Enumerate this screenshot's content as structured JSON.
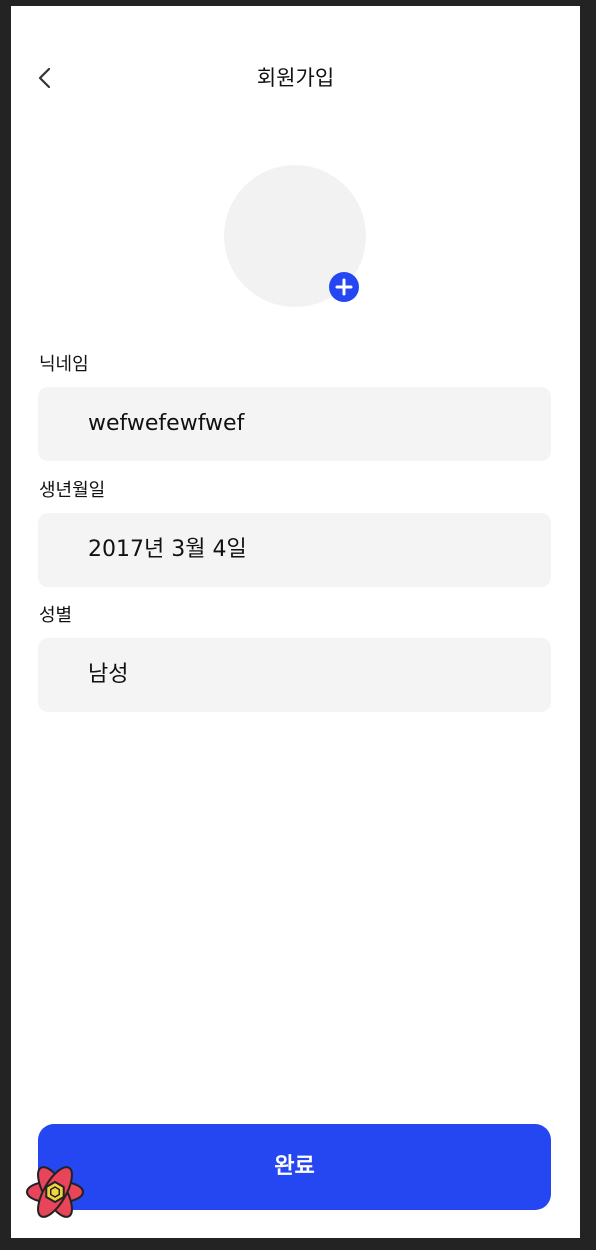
{
  "header": {
    "title": "회원가입",
    "back_icon": "chevron-left-icon"
  },
  "avatar": {
    "add_icon": "plus-icon",
    "accent": "#2447f2"
  },
  "form": {
    "nickname": {
      "label": "닉네임",
      "value": "wefwefewfwef"
    },
    "birthdate": {
      "label": "생년월일",
      "value": "2017년 3월 4일"
    },
    "gender": {
      "label": "성별",
      "value": "남성"
    }
  },
  "submit": {
    "label": "완료",
    "color": "#2447f2"
  },
  "overlay": {
    "icon": "react-devtools-icon"
  }
}
